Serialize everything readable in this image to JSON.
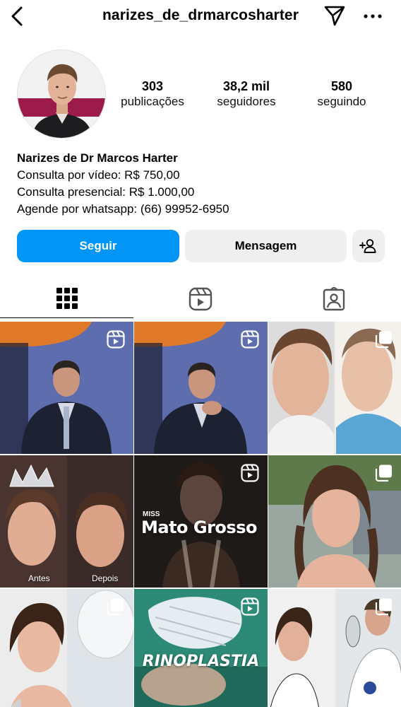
{
  "header": {
    "username": "narizes_de_drmarcosharter",
    "back_icon": "chevron-left-icon",
    "send_icon": "paper-plane-icon",
    "more_icon": "more-dots-icon"
  },
  "profile": {
    "stats": {
      "posts": {
        "value": "303",
        "label": "publicações"
      },
      "followers": {
        "value": "38,2 mil",
        "label": "seguidores"
      },
      "following": {
        "value": "580",
        "label": "seguindo"
      }
    },
    "bio": {
      "name": "Narizes de Dr Marcos Harter",
      "lines": [
        "Consulta por vídeo: R$ 750,00",
        "Consulta presencial: R$ 1.000,00",
        "Agende por whatsapp: (66) 99952-6950"
      ]
    }
  },
  "actions": {
    "follow_label": "Seguir",
    "message_label": "Mensagem",
    "add_user_icon": "add-person-icon"
  },
  "tabs": [
    {
      "icon": "grid-icon",
      "active": true
    },
    {
      "icon": "reels-icon",
      "active": false
    },
    {
      "icon": "tagged-icon",
      "active": false
    }
  ],
  "posts": [
    {
      "type": "reel"
    },
    {
      "type": "reel"
    },
    {
      "type": "carousel"
    },
    {
      "type": "image",
      "overlay": [
        "Antes",
        "Depois"
      ]
    },
    {
      "type": "reel",
      "overlay": [
        "MISS",
        "Mato Grosso"
      ]
    },
    {
      "type": "carousel"
    },
    {
      "type": "carousel"
    },
    {
      "type": "reel",
      "overlay": [
        "RINOPLASTIA"
      ]
    },
    {
      "type": "carousel"
    }
  ],
  "colors": {
    "accent": "#0095f6",
    "button_gray": "#efefef"
  }
}
